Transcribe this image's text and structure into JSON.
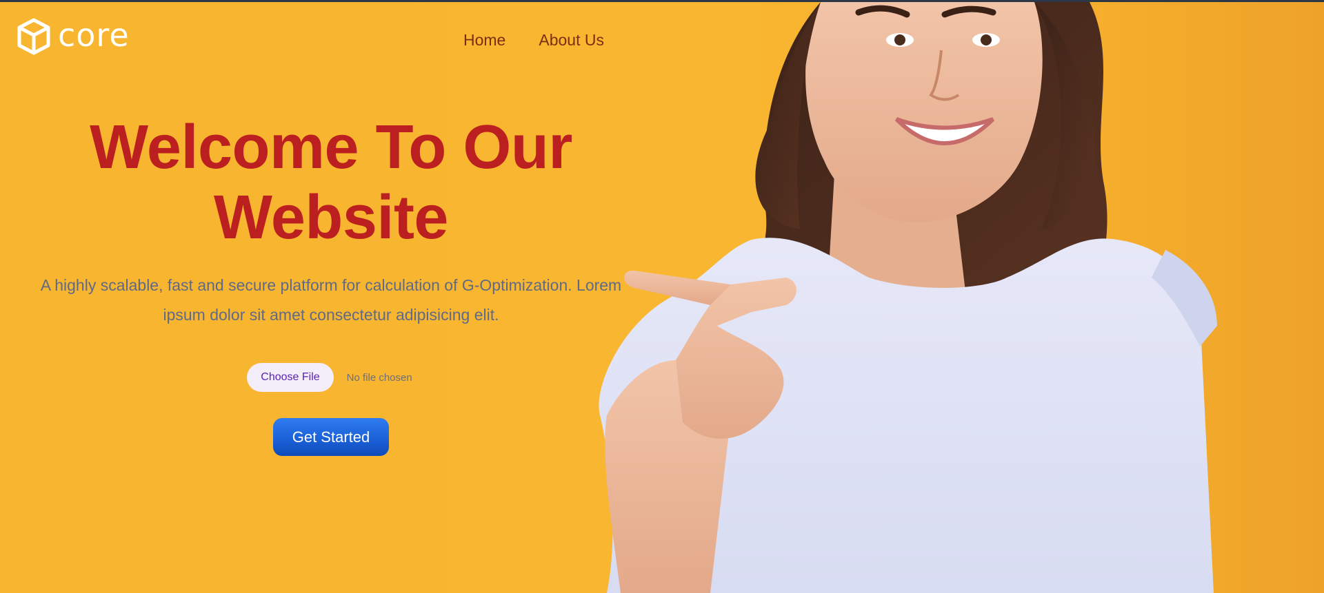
{
  "brand": {
    "name": "core",
    "logo_icon": "cube-icon",
    "color": "#ffffff"
  },
  "nav": {
    "items": [
      {
        "label": "Home"
      },
      {
        "label": "About Us"
      }
    ]
  },
  "hero": {
    "headline_line1": "Welcome To Our",
    "headline_line2": "Website",
    "subtitle_line1": "A highly scalable, fast and secure platform for calculation of G-Optimization. Lorem",
    "subtitle_line2": "ipsum dolor sit amet consectetur adipisicing elit.",
    "file_input": {
      "button_label": "Choose File",
      "status_text": "No file chosen"
    },
    "cta_label": "Get Started",
    "image": "smiling-woman-pointing-photo"
  },
  "colors": {
    "background": "#f8b52f",
    "headline": "#bb1f1f",
    "nav_text": "#7a2f12",
    "subtitle": "#5f6a87",
    "cta": "#1a5fd6",
    "file_button_text": "#5b21b6"
  }
}
